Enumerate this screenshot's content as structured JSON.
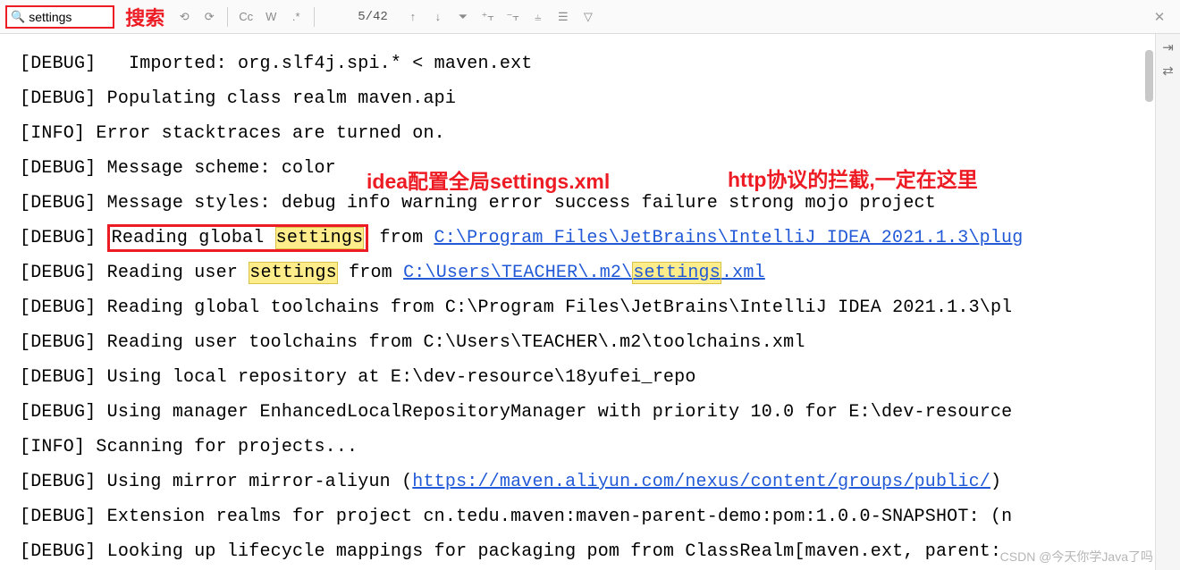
{
  "toolbar": {
    "search_value": "settings",
    "annot_search": "搜索",
    "prev_icon": "⟲",
    "next_icon": "⟳",
    "cc": "Cc",
    "word": "W",
    "regex": ".*",
    "match_count": "5/42",
    "up": "↑",
    "down": "↓",
    "filter": "⏷",
    "close": "✕"
  },
  "lines": [
    {
      "pre": "[DEBUG]   Imported: org.slf4j.spi.* < maven.ext"
    },
    {
      "pre": "[DEBUG] Populating class realm maven.api"
    },
    {
      "pre": "[INFO] Error stacktraces are turned on."
    },
    {
      "pre": "[DEBUG] Message scheme: color"
    },
    {
      "pre": "[DEBUG] Message styles: debug info warning error success failure strong mojo project"
    },
    {
      "segs": [
        {
          "t": "[DEBUG] "
        },
        {
          "t": "Reading global ",
          "cls": "red-box-start"
        },
        {
          "t": "settings",
          "cls": "hl"
        },
        {
          "t": " from ",
          "cls": "red-box-end"
        },
        {
          "t": "C:\\Program Files\\JetBrains\\IntelliJ IDEA 2021.1.3\\plug",
          "cls": "link"
        }
      ],
      "redbox": true
    },
    {
      "segs": [
        {
          "t": "[DEBUG] Reading user "
        },
        {
          "t": "settings",
          "cls": "hl"
        },
        {
          "t": " from "
        },
        {
          "t": "C:\\Users\\TEACHER\\.m2\\",
          "cls": "link"
        },
        {
          "t": "settings",
          "cls": "link hl"
        },
        {
          "t": ".xml",
          "cls": "link"
        }
      ]
    },
    {
      "pre": "[DEBUG] Reading global toolchains from C:\\Program Files\\JetBrains\\IntelliJ IDEA 2021.1.3\\pl"
    },
    {
      "pre": "[DEBUG] Reading user toolchains from C:\\Users\\TEACHER\\.m2\\toolchains.xml"
    },
    {
      "pre": "[DEBUG] Using local repository at E:\\dev-resource\\18yufei_repo"
    },
    {
      "pre": "[DEBUG] Using manager EnhancedLocalRepositoryManager with priority 10.0 for E:\\dev-resource"
    },
    {
      "pre": "[INFO] Scanning for projects..."
    },
    {
      "segs": [
        {
          "t": "[DEBUG] Using mirror mirror-aliyun ("
        },
        {
          "t": "https://maven.aliyun.com/nexus/content/groups/public/",
          "cls": "link"
        },
        {
          "t": ")"
        }
      ]
    },
    {
      "pre": "[DEBUG] Extension realms for project cn.tedu.maven:maven-parent-demo:pom:1.0.0-SNAPSHOT: (n"
    },
    {
      "pre": "[DEBUG] Looking up lifecycle mappings for packaging pom from ClassRealm[maven.ext, parent:"
    }
  ],
  "annotations": {
    "a1": "idea配置全局settings.xml",
    "a2": "http协议的拦截,一定在这里"
  },
  "watermark": "CSDN @今天你学Java了吗"
}
